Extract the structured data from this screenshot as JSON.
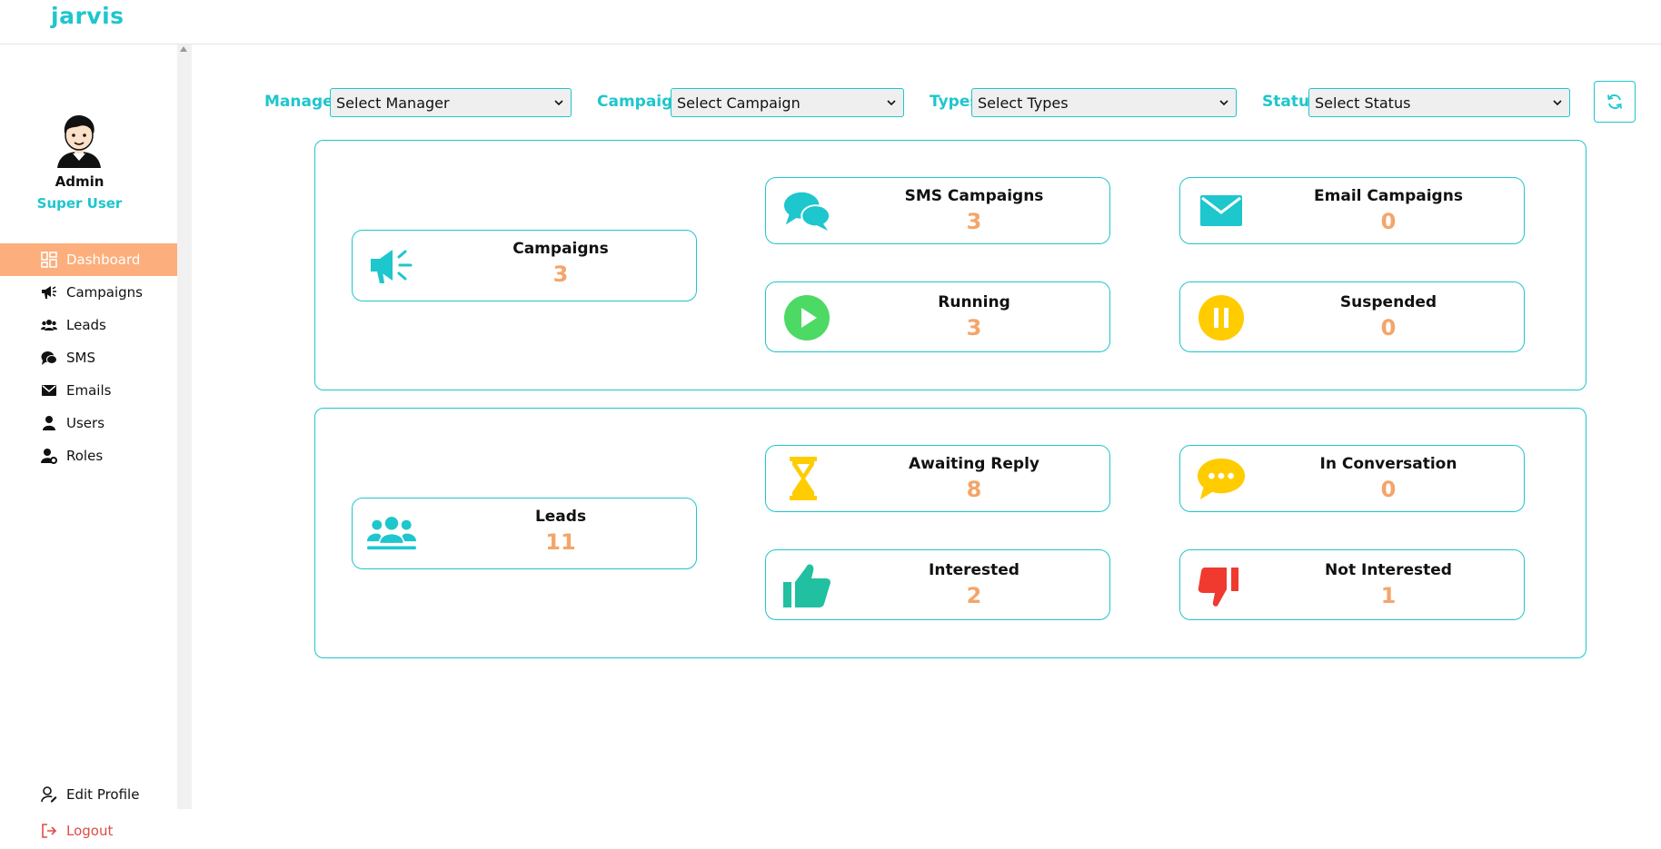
{
  "app": {
    "brand": "jarvis"
  },
  "user": {
    "name": "Admin",
    "role": "Super User"
  },
  "sidebar": {
    "items": [
      {
        "label": "Dashboard",
        "icon": "dashboard-icon",
        "active": true
      },
      {
        "label": "Campaigns",
        "icon": "megaphone-icon"
      },
      {
        "label": "Leads",
        "icon": "users-group-icon"
      },
      {
        "label": "SMS",
        "icon": "chat-icon"
      },
      {
        "label": "Emails",
        "icon": "envelope-icon"
      },
      {
        "label": "Users",
        "icon": "user-icon"
      },
      {
        "label": "Roles",
        "icon": "user-cog-icon"
      }
    ],
    "bottom": [
      {
        "label": "Edit Profile",
        "icon": "user-edit-icon"
      },
      {
        "label": "Logout",
        "icon": "logout-icon"
      }
    ]
  },
  "filters": {
    "manager": {
      "label": "Manager",
      "value": "Select Manager"
    },
    "campaign": {
      "label": "Campaign",
      "value": "Select Campaign"
    },
    "types": {
      "label": "Types",
      "value": "Select Types"
    },
    "status": {
      "label": "Status",
      "value": "Select Status"
    }
  },
  "campaign_stats": {
    "campaigns": {
      "title": "Campaigns",
      "value": "3"
    },
    "sms_campaigns": {
      "title": "SMS Campaigns",
      "value": "3"
    },
    "email_campaigns": {
      "title": "Email Campaigns",
      "value": "0"
    },
    "running": {
      "title": "Running",
      "value": "3"
    },
    "suspended": {
      "title": "Suspended",
      "value": "0"
    }
  },
  "lead_stats": {
    "leads": {
      "title": "Leads",
      "value": "11"
    },
    "awaiting_reply": {
      "title": "Awaiting Reply",
      "value": "8"
    },
    "in_conversation": {
      "title": "In Conversation",
      "value": "0"
    },
    "interested": {
      "title": "Interested",
      "value": "2"
    },
    "not_interested": {
      "title": "Not Interested",
      "value": "1"
    }
  },
  "colors": {
    "accent": "#1ec6cd",
    "active_nav": "#fcae7c",
    "value_text": "#f4a56a",
    "running_green": "#4cd964",
    "suspended_yellow": "#ffcc00",
    "interested_green": "#20c0a0",
    "not_interested_red": "#f03a30",
    "logout_red": "#e04b45"
  }
}
